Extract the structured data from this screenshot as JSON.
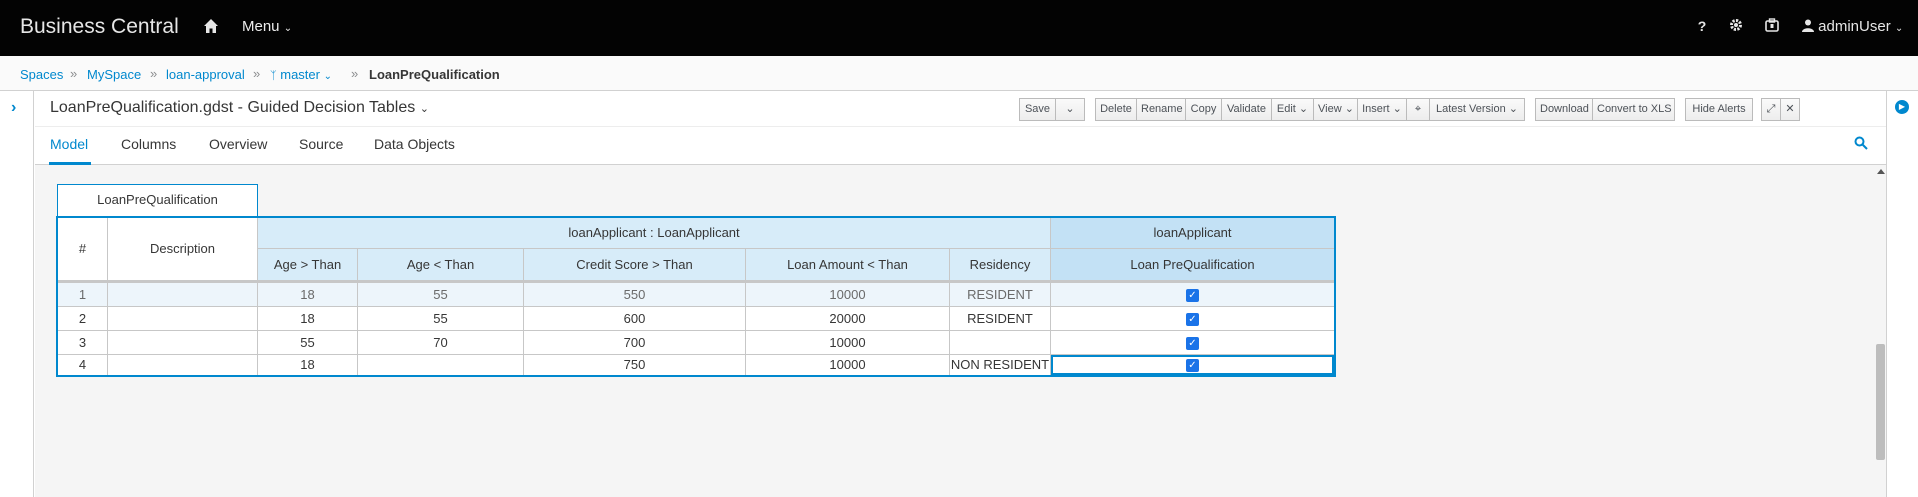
{
  "navbar": {
    "brand": "Business Central",
    "menu_label": "Menu",
    "user_label": "adminUser",
    "help_label": "?"
  },
  "breadcrumb": {
    "items": [
      "Spaces",
      "MySpace",
      "loan-approval",
      "master",
      "LoanPreQualification"
    ],
    "separator": "»"
  },
  "editor": {
    "title": "LoanPreQualification.gdst - Guided Decision Tables",
    "toolbar": {
      "save": "Save",
      "delete": "Delete",
      "rename": "Rename",
      "copy": "Copy",
      "validate": "Validate",
      "edit": "Edit",
      "view": "View",
      "insert": "Insert",
      "latest_version": "Latest Version",
      "download": "Download",
      "convert": "Convert to XLS",
      "hide_alerts": "Hide Alerts"
    },
    "tabs": [
      "Model",
      "Columns",
      "Overview",
      "Source",
      "Data Objects"
    ],
    "active_tab": "Model"
  },
  "table": {
    "name": "LoanPreQualification",
    "row_number_header": "#",
    "description_header": "Description",
    "pattern_header": "loanApplicant : LoanApplicant",
    "action_header": "loanApplicant",
    "columns": [
      "Age > Than",
      "Age < Than",
      "Credit Score > Than",
      "Loan Amount < Than",
      "Residency",
      "Loan PreQualification"
    ],
    "rows": [
      {
        "num": "1",
        "desc": "",
        "c1": "18",
        "c2": "55",
        "c3": "550",
        "c4": "10000",
        "c5": "RESIDENT",
        "checked": true
      },
      {
        "num": "2",
        "desc": "",
        "c1": "18",
        "c2": "55",
        "c3": "600",
        "c4": "20000",
        "c5": "RESIDENT",
        "checked": true
      },
      {
        "num": "3",
        "desc": "",
        "c1": "55",
        "c2": "70",
        "c3": "700",
        "c4": "10000",
        "c5": "",
        "checked": true
      },
      {
        "num": "4",
        "desc": "",
        "c1": "18",
        "c2": "",
        "c3": "750",
        "c4": "10000",
        "c5": "NON RESIDENT",
        "checked": true
      }
    ]
  },
  "colors": {
    "accent": "#0088ce",
    "navbar_bg": "#030303",
    "pattern_header_bg": "#d7ecf9",
    "action_header_bg": "#c3e1f5"
  }
}
